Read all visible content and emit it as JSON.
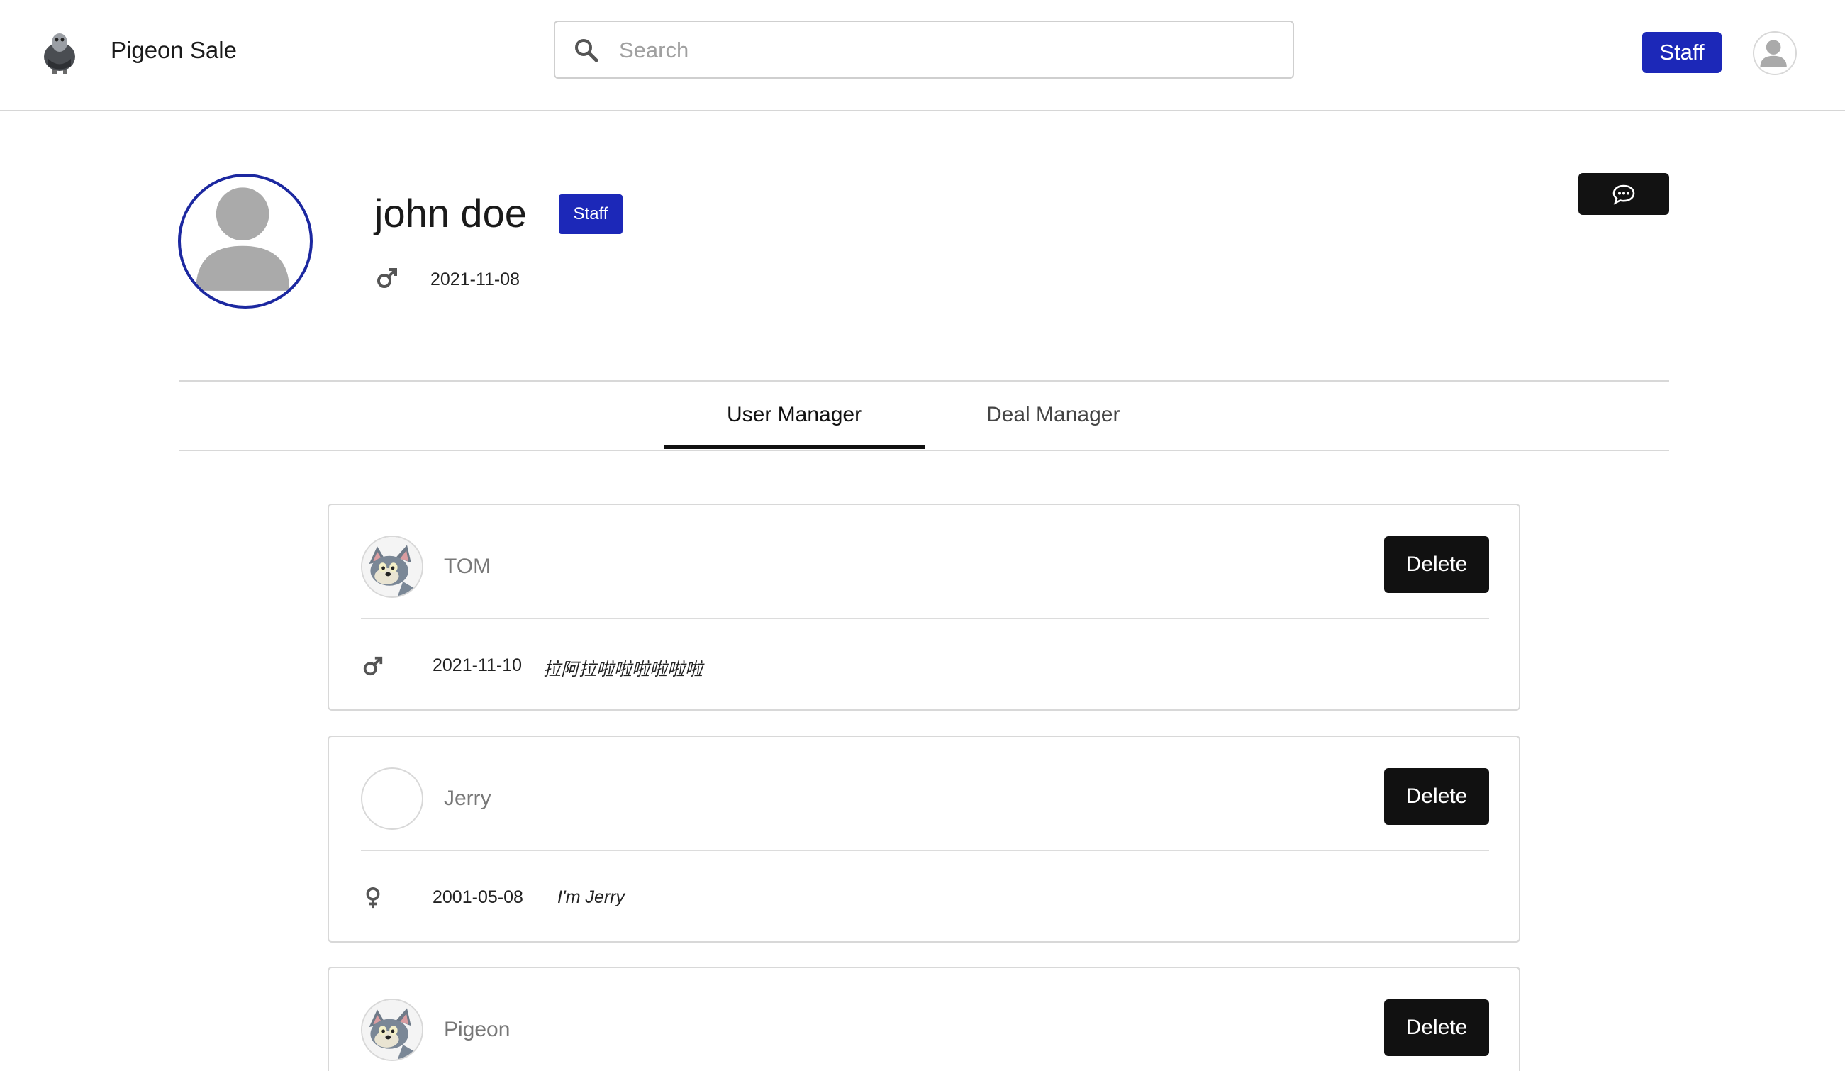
{
  "header": {
    "brand": "Pigeon Sale",
    "search_placeholder": "Search",
    "staff_button": "Staff",
    "logo_icon": "pigeon-logo-icon",
    "avatar_icon": "user-avatar-icon"
  },
  "profile": {
    "name": "john doe",
    "role_badge": "Staff",
    "gender_icon": "male-icon",
    "date": "2021-11-08",
    "message_icon": "chat-bubble-icon"
  },
  "tabs": [
    {
      "label": "User Manager",
      "active": true
    },
    {
      "label": "Deal Manager",
      "active": false
    }
  ],
  "users": [
    {
      "name": "TOM",
      "gender_icon": "male-icon",
      "date": "2021-11-10",
      "bio": "拉阿拉啦啦啦啦啦啦",
      "avatar": "tom-cat-avatar",
      "delete_label": "Delete"
    },
    {
      "name": "Jerry",
      "gender_icon": "female-icon",
      "date": "2001-05-08",
      "bio": "I'm Jerry",
      "avatar": "empty-avatar",
      "delete_label": "Delete"
    },
    {
      "name": "Pigeon",
      "gender_icon": "",
      "date": "",
      "bio": "",
      "avatar": "tom-cat-avatar",
      "delete_label": "Delete"
    }
  ],
  "colors": {
    "accent": "#1c28b8",
    "avatar_ring": "#1c28a0",
    "button_dark": "#111111"
  }
}
